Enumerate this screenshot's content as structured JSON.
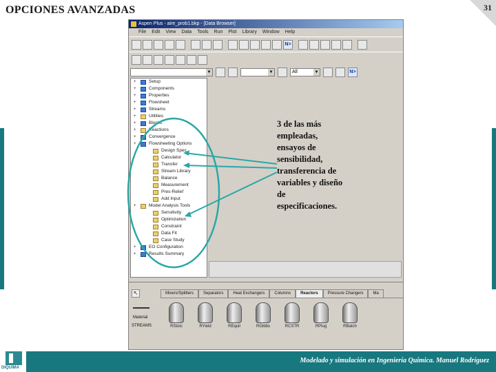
{
  "slide": {
    "title": "OPCIONES AVANZADAS",
    "page_number": "31",
    "footer": "Modelado y simulación en Ingeniería Química. Manuel Rodríguez",
    "logo_text": "DIQUIMA",
    "accent_color": "#17787f"
  },
  "app": {
    "window_title": "Aspen Plus - aire_prob1.bkp - [Data Browser]",
    "menu": [
      "File",
      "Edit",
      "View",
      "Data",
      "Tools",
      "Run",
      "Plot",
      "Library",
      "Window",
      "Help"
    ],
    "nav_combo_value": "All",
    "next_button_label": "N>",
    "toolbar_n_label": "N>",
    "tree": [
      {
        "label": "Setup",
        "icon": "check-icon",
        "depth": 0
      },
      {
        "label": "Components",
        "icon": "check-icon",
        "depth": 0
      },
      {
        "label": "Properties",
        "icon": "check-icon",
        "depth": 0
      },
      {
        "label": "Flowsheet",
        "icon": "check-icon",
        "depth": 0
      },
      {
        "label": "Streams",
        "icon": "check-icon",
        "depth": 0
      },
      {
        "label": "Utilities",
        "icon": "folder-icon",
        "depth": 0
      },
      {
        "label": "Blocks",
        "icon": "check-icon",
        "depth": 0
      },
      {
        "label": "Reactions",
        "icon": "folder-icon",
        "depth": 0
      },
      {
        "label": "Convergence",
        "icon": "check-icon",
        "depth": 0
      },
      {
        "label": "Flowsheeting Options",
        "icon": "check-icon",
        "depth": 0
      },
      {
        "label": "Design Spec",
        "icon": "folder-icon",
        "depth": 1
      },
      {
        "label": "Calculator",
        "icon": "folder-icon",
        "depth": 1
      },
      {
        "label": "Transfer",
        "icon": "folder-icon",
        "depth": 1
      },
      {
        "label": "Stream Library",
        "icon": "folder-icon",
        "depth": 1
      },
      {
        "label": "Balance",
        "icon": "folder-icon",
        "depth": 1
      },
      {
        "label": "Measurement",
        "icon": "folder-icon",
        "depth": 1
      },
      {
        "label": "Pres-Relief",
        "icon": "folder-icon",
        "depth": 1
      },
      {
        "label": "Add Input",
        "icon": "folder-icon",
        "depth": 1
      },
      {
        "label": "Model Analysis Tools",
        "icon": "folder-icon",
        "depth": 0
      },
      {
        "label": "Sensitivity",
        "icon": "folder-icon",
        "depth": 1
      },
      {
        "label": "Optimization",
        "icon": "folder-icon",
        "depth": 1
      },
      {
        "label": "Constraint",
        "icon": "folder-icon",
        "depth": 1
      },
      {
        "label": "Data Fit",
        "icon": "folder-icon",
        "depth": 1
      },
      {
        "label": "Case Study",
        "icon": "folder-icon",
        "depth": 1
      },
      {
        "label": "EO Configuration",
        "icon": "check-icon",
        "depth": 0
      },
      {
        "label": "Results Summary",
        "icon": "check-icon",
        "depth": 0
      }
    ],
    "palette": {
      "tabs": [
        "Mixers/Splitters",
        "Separators",
        "Heat Exchangers",
        "Columns",
        "Reactors",
        "Pressure Changers",
        "Ma"
      ],
      "active_tab": "Reactors",
      "material_label": "Material",
      "streams_label": "STREAMS",
      "blocks": [
        "RStoic",
        "RYield",
        "REquil",
        "RGibbs",
        "RCSTR",
        "RPlug",
        "RBatch"
      ]
    }
  },
  "annotation": {
    "lines": [
      "3 de las más",
      "empleadas,",
      "ensayos de",
      "sensibilidad,",
      "transferencia de",
      "variables y diseño",
      "de",
      "especificaciones."
    ]
  }
}
